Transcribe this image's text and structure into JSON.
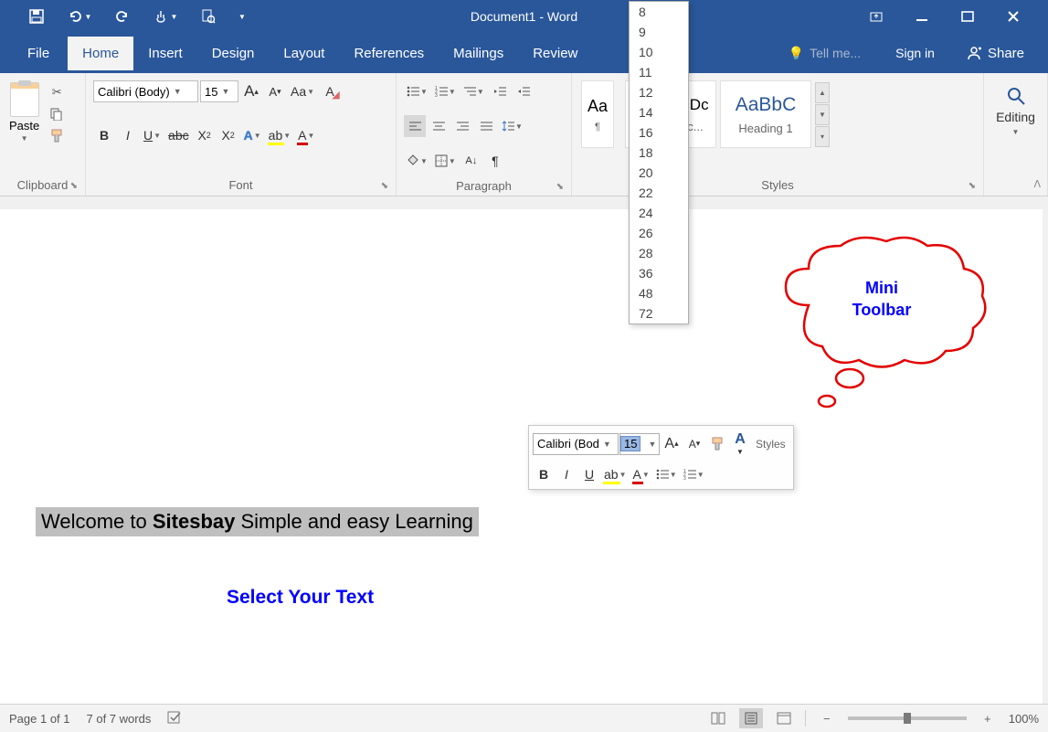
{
  "title": "Document1 - Word",
  "qat": {
    "save": "save-icon",
    "undo": "undo-icon",
    "redo": "redo-icon",
    "touch": "touch-icon",
    "preview": "preview-icon"
  },
  "menu": {
    "file": "File",
    "home": "Home",
    "insert": "Insert",
    "design": "Design",
    "layout": "Layout",
    "references": "References",
    "mailings": "Mailings",
    "review": "Review"
  },
  "tellme": "Tell me...",
  "signin": "Sign in",
  "share": "Share",
  "ribbon": {
    "clipboard": {
      "paste": "Paste",
      "label": "Clipboard"
    },
    "font": {
      "name": "Calibri (Body)",
      "size": "15",
      "label": "Font"
    },
    "paragraph": {
      "label": "Paragraph"
    },
    "styles": {
      "label": "Styles",
      "item1": {
        "prev": "Aa",
        "name": ""
      },
      "item2": {
        "prev": "AaBbCcDc",
        "name": "¶ No Spac..."
      },
      "item3": {
        "prev": "AaBbC",
        "name": "Heading 1"
      }
    },
    "editing": {
      "label": "Editing"
    }
  },
  "sizeOptions": [
    "8",
    "9",
    "10",
    "11",
    "12",
    "14",
    "16",
    "18",
    "20",
    "22",
    "24",
    "26",
    "28",
    "36",
    "48",
    "72"
  ],
  "doc": {
    "selected_pre": "Welcome to ",
    "selected_bold": "Sitesbay",
    "selected_post": " Simple and easy Learning",
    "blue": "Select Your Text"
  },
  "callout": {
    "line1": "Mini",
    "line2": "Toolbar"
  },
  "mini": {
    "font": "Calibri (Bod",
    "size": "15",
    "styles": "Styles"
  },
  "status": {
    "page": "Page 1 of 1",
    "words": "7 of 7 words",
    "zoom": "100%"
  }
}
